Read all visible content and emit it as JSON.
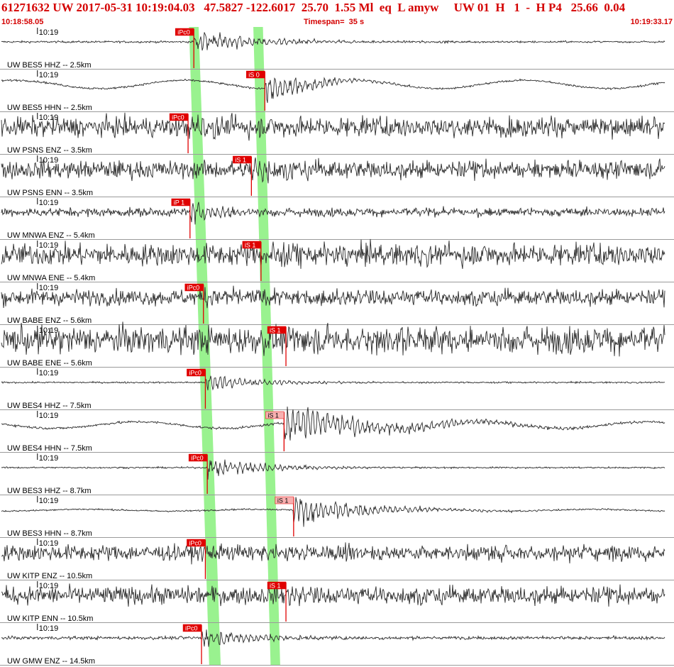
{
  "header": {
    "event_line": "61271632 UW 2017-05-31 10:19:04.03   47.5827 -122.6017  25.70  1.55 Ml  eq  L amyw     UW 01  H   1  -  H P4   25.66  0.04",
    "start_time": "10:18:58.05",
    "timespan": "Timespan=  35 s",
    "end_time": "10:19:33.17"
  },
  "colors": {
    "header_text": "#d40000",
    "pick_flag": "#e00000",
    "pick_flag_light": "#f7b0b0",
    "trace": "#2b2b2b",
    "highlight_band": "#99f28f"
  },
  "tick_label": "10:19",
  "chart_data": {
    "type": "line",
    "title": "",
    "x_range_s": [
      0,
      35.12
    ],
    "x_start_time": "10:18:58.05",
    "x_end_time": "10:19:33.17",
    "minute_tick_s": 1.95,
    "highlight_bands": [
      {
        "name": "P window",
        "start_s": [
          9.85,
          10.35
        ],
        "end_s": [
          10.9,
          11.5
        ]
      },
      {
        "name": "S window",
        "start_s": [
          13.2,
          13.7
        ],
        "end_s": [
          14.1,
          14.6
        ]
      }
    ],
    "traces": [
      {
        "label": "UW BES5 HHZ -- 2.5km",
        "pick": "iPc0",
        "pick_s": 10.1,
        "style": "p",
        "noise": 0.05,
        "wave": 0.0,
        "event": 0.6,
        "decay": 8
      },
      {
        "label": "UW BES5 HHN -- 2.5km",
        "pick": "iS 0",
        "pick_s": 13.8,
        "style": "s",
        "noise": 0.05,
        "wave": 0.45,
        "event": 0.9,
        "decay": 5
      },
      {
        "label": "UW PSNS ENZ -- 3.5km",
        "pick": "iPc0",
        "pick_s": 9.8,
        "style": "p",
        "noise": 0.5,
        "wave": 0.0,
        "event": 0.6,
        "decay": 6
      },
      {
        "label": "UW PSNS ENN -- 3.5km",
        "pick": "iS 1",
        "pick_s": 13.1,
        "style": "s",
        "noise": 0.45,
        "wave": 0.0,
        "event": 0.6,
        "decay": 4
      },
      {
        "label": "UW MNWA ENZ -- 5.4km",
        "pick": "iP 1",
        "pick_s": 9.9,
        "style": "p",
        "noise": 0.22,
        "wave": 0.0,
        "event": 0.55,
        "decay": 4
      },
      {
        "label": "UW MNWA ENE -- 5.4km",
        "pick": "iS 1",
        "pick_s": 13.6,
        "style": "s",
        "noise": 0.55,
        "wave": 0.0,
        "event": 0.5,
        "decay": 3
      },
      {
        "label": "UW BABE ENZ -- 5.6km",
        "pick": "iPc0",
        "pick_s": 10.6,
        "style": "p",
        "noise": 0.4,
        "wave": 0.0,
        "event": 0.4,
        "decay": 3
      },
      {
        "label": "UW BABE ENE -- 5.6km",
        "pick": "iS 1",
        "pick_s": 14.9,
        "style": "s",
        "noise": 0.7,
        "wave": 0.0,
        "event": 0.4,
        "decay": 3
      },
      {
        "label": "UW BES4 HHZ -- 7.5km",
        "pick": "iPc0",
        "pick_s": 10.7,
        "style": "p",
        "noise": 0.04,
        "wave": 0.0,
        "event": 0.5,
        "decay": 6
      },
      {
        "label": "UW BES4 HHN -- 7.5km",
        "pick": "iS 1",
        "pick_s": 14.8,
        "style": "s",
        "noise": 0.06,
        "wave": 0.35,
        "event": 1.0,
        "decay": 12
      },
      {
        "label": "UW BES3 HHZ -- 8.7km",
        "pick": "iPc0",
        "pick_s": 10.8,
        "style": "p",
        "noise": 0.04,
        "wave": 0.0,
        "event": 0.6,
        "decay": 7
      },
      {
        "label": "UW BES3 HHN -- 8.7km",
        "pick": "iS 1",
        "pick_s": 15.3,
        "style": "s",
        "noise": 0.04,
        "wave": 0.1,
        "event": 0.9,
        "decay": 8
      },
      {
        "label": "UW KITP ENZ -- 10.5km",
        "pick": "iPc0",
        "pick_s": 10.7,
        "style": "p",
        "noise": 0.4,
        "wave": 0.0,
        "event": 0.3,
        "decay": 3
      },
      {
        "label": "UW KITP ENN -- 10.5km",
        "pick": "iS 1",
        "pick_s": 14.9,
        "style": "s",
        "noise": 0.45,
        "wave": 0.0,
        "event": 0.3,
        "decay": 3
      },
      {
        "label": "UW GMW ENZ -- 14.5km",
        "pick": "iPc0",
        "pick_s": 10.5,
        "style": "p",
        "noise": 0.08,
        "wave": 0.0,
        "event": 0.5,
        "decay": 7
      }
    ]
  }
}
